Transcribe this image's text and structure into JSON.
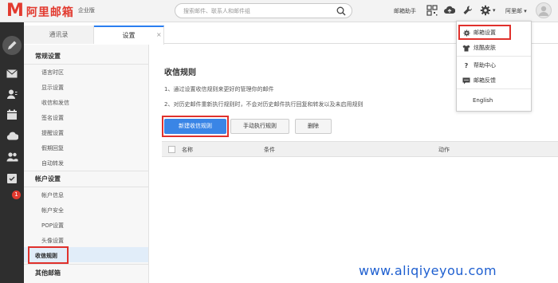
{
  "header": {
    "logo_m": "M",
    "logo_text": "阿里邮箱",
    "edition": "企业版",
    "search_placeholder": "搜索邮件、联系人和邮件组",
    "assistant": "邮箱助手",
    "user": "阿里邮 ▾"
  },
  "left_rail": {
    "badge": "1"
  },
  "tabs": [
    {
      "label": "通讯录"
    },
    {
      "label": "设置"
    }
  ],
  "nav": {
    "groups": [
      {
        "title": "常规设置",
        "items": [
          "语言时区",
          "显示设置",
          "收信和发信",
          "签名设置",
          "提醒设置",
          "假期回复",
          "自动转发"
        ]
      },
      {
        "title": "帐户设置",
        "items": [
          "帐户信息",
          "帐户安全",
          "POP设置",
          "头像设置",
          "收信规则"
        ]
      },
      {
        "title": "其他邮箱",
        "items": []
      }
    ]
  },
  "content": {
    "title": "收信规则",
    "desc1": "1、通过设置收信规则来更好的管理你的邮件",
    "desc2": "2、对历史邮件重新执行规则时，不会对历史邮件执行回复和转发以及未启用规则",
    "buttons": {
      "new_rule": "新建收信规则",
      "run_rule": "手动执行规则",
      "delete": "删除"
    },
    "columns": [
      "名称",
      "条件",
      "动作"
    ]
  },
  "dropdown": {
    "items": [
      "邮箱设置",
      "炫酷皮肤",
      "帮助中心",
      "邮箱反馈",
      "English"
    ]
  },
  "watermark": "www.aliqiyeyou.com",
  "colors": {
    "brand_red": "#e23a2f",
    "primary_blue": "#3a85e6",
    "highlight_red": "#e0312c"
  }
}
